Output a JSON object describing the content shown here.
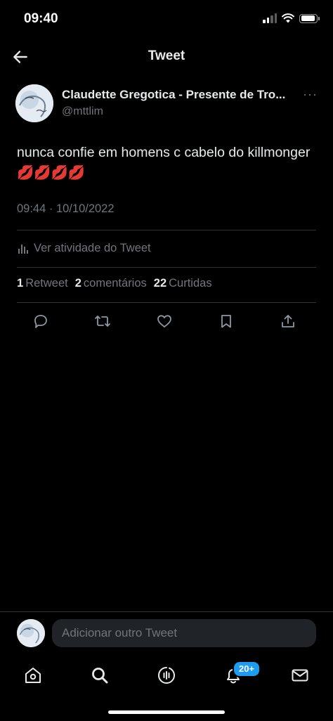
{
  "status_bar": {
    "time": "09:40"
  },
  "nav": {
    "title": "Tweet"
  },
  "tweet": {
    "display_name": "Claudette Gregotica - Presente de Tro...",
    "handle": "@mttlim",
    "text": "nunca confie em homens c cabelo do killmonger 💋💋💋💋",
    "timestamp": "09:44 · 10/10/2022",
    "activity_label": "Ver atividade do Tweet",
    "stats": [
      {
        "count": "1",
        "label": "Retweet"
      },
      {
        "count": "2",
        "label": "comentários"
      },
      {
        "count": "22",
        "label": "Curtidas"
      }
    ]
  },
  "compose": {
    "placeholder": "Adicionar outro Tweet"
  },
  "tabbar": {
    "notifications_badge": "20+"
  },
  "icons": {
    "back": "arrow-left-icon",
    "more": "more-horizontal-icon",
    "activity": "bar-chart-icon",
    "reply": "comment-icon",
    "retweet": "retweet-icon",
    "like": "heart-icon",
    "bookmark": "bookmark-icon",
    "share": "share-icon",
    "home": "home-icon",
    "search": "search-icon",
    "spaces": "spaces-icon",
    "notifications": "bell-icon",
    "messages": "envelope-icon"
  },
  "colors": {
    "background": "#000000",
    "text": "#e7e9ea",
    "secondary": "#71767b",
    "accent": "#1d9bf0",
    "divider": "#2f3336"
  }
}
